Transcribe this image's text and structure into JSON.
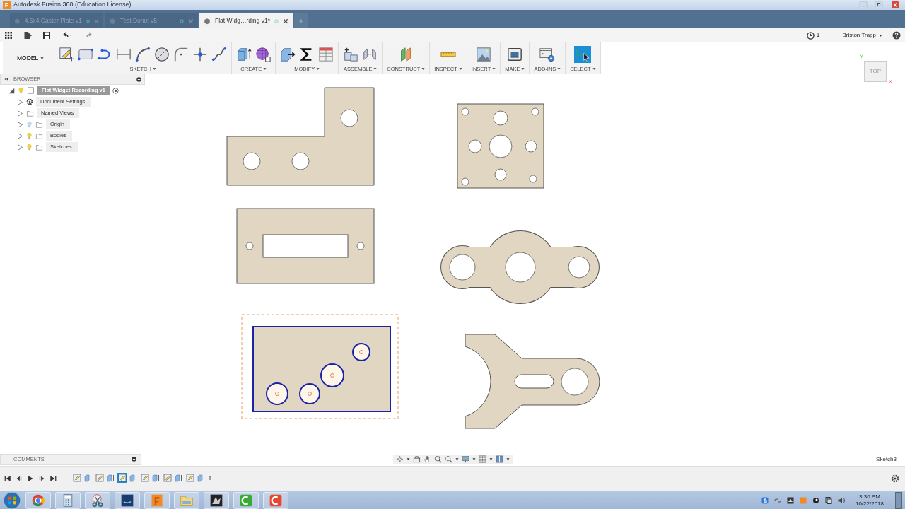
{
  "window": {
    "logo": "F",
    "title": "Autodesk Fusion 360 (Education License)"
  },
  "tabs": [
    {
      "label": "4.5x4 Caster Plate v1",
      "selected": false
    },
    {
      "label": "Test Donut v5",
      "selected": false
    },
    {
      "label": "Flat Widg…rding v1*",
      "selected": true
    }
  ],
  "quick_bar": {
    "job_count": "1",
    "user": "Briston Trapp"
  },
  "ribbon": {
    "workspace": "MODEL",
    "groups": [
      {
        "label": "SKETCH"
      },
      {
        "label": "CREATE"
      },
      {
        "label": "MODIFY"
      },
      {
        "label": "ASSEMBLE"
      },
      {
        "label": "CONSTRUCT"
      },
      {
        "label": "INSPECT"
      },
      {
        "label": "INSERT"
      },
      {
        "label": "MAKE"
      },
      {
        "label": "ADD-INS"
      },
      {
        "label": "SELECT"
      }
    ],
    "select_tool": {
      "active": true
    }
  },
  "browser": {
    "title": "BROWSER",
    "root": {
      "label": "Flat Widget Recording v1",
      "expanded": true,
      "visible": true,
      "selected": true
    },
    "items": [
      {
        "label": "Document Settings",
        "kind": "settings",
        "expanded": false,
        "selected": false
      },
      {
        "label": "Named Views",
        "kind": "folder",
        "expanded": false,
        "selected": false
      },
      {
        "label": "Origin",
        "kind": "folder",
        "expanded": false,
        "visible": false,
        "selected": false
      },
      {
        "label": "Bodies",
        "kind": "folder",
        "expanded": false,
        "visible": true,
        "selected": false
      },
      {
        "label": "Sketches",
        "kind": "folder",
        "expanded": false,
        "visible": true,
        "selected": false
      }
    ]
  },
  "view_cube": {
    "face": "TOP",
    "axis_x": "X",
    "axis_y": "Y"
  },
  "comments": {
    "title": "COMMENTS"
  },
  "status": {
    "active_item": "Sketch3"
  },
  "timeline": {
    "features": [
      {
        "kind": "sketch",
        "selected": false
      },
      {
        "kind": "extrude",
        "selected": false
      },
      {
        "kind": "sketch",
        "selected": false
      },
      {
        "kind": "extrude",
        "selected": false
      },
      {
        "kind": "sketch",
        "selected": true
      },
      {
        "kind": "extrude",
        "selected": false
      },
      {
        "kind": "sketch",
        "selected": false
      },
      {
        "kind": "extrude",
        "selected": false
      },
      {
        "kind": "sketch",
        "selected": false
      },
      {
        "kind": "extrude",
        "selected": false
      },
      {
        "kind": "sketch",
        "selected": false
      },
      {
        "kind": "extrude",
        "selected": false
      }
    ]
  },
  "taskbar": {
    "time": "3:30 PM",
    "date": "10/22/2018"
  }
}
